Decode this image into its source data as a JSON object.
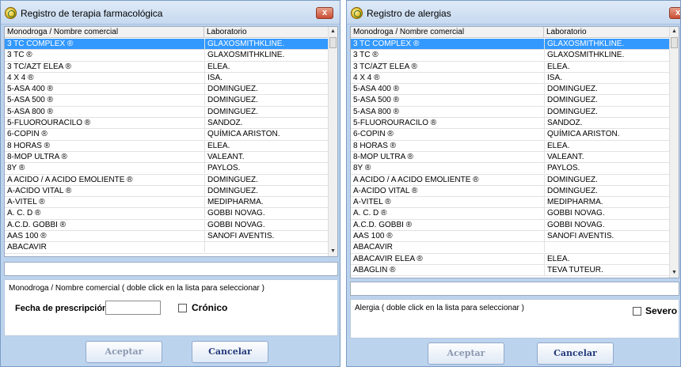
{
  "left_window": {
    "title": "Registro de terapia farmacológica",
    "close_label": "x",
    "columns": {
      "name": "Monodroga / Nombre comercial",
      "lab": "Laboratorio"
    },
    "rows": [
      {
        "name": "3 TC COMPLEX ®",
        "lab": "GLAXOSMITHKLINE."
      },
      {
        "name": "3 TC ®",
        "lab": "GLAXOSMITHKLINE."
      },
      {
        "name": "3 TC/AZT ELEA ®",
        "lab": "ELEA."
      },
      {
        "name": "4 X 4 ®",
        "lab": "ISA."
      },
      {
        "name": "5-ASA 400 ®",
        "lab": "DOMINGUEZ."
      },
      {
        "name": "5-ASA 500 ®",
        "lab": "DOMINGUEZ."
      },
      {
        "name": "5-ASA 800 ®",
        "lab": "DOMINGUEZ."
      },
      {
        "name": "5-FLUOROURACILO ®",
        "lab": "SANDOZ."
      },
      {
        "name": "6-COPIN ®",
        "lab": "QUÍMICA ARISTON."
      },
      {
        "name": "8 HORAS ®",
        "lab": "ELEA."
      },
      {
        "name": "8-MOP ULTRA ®",
        "lab": "VALEANT."
      },
      {
        "name": "8Y ®",
        "lab": "PAYLOS."
      },
      {
        "name": "A ACIDO / A ACIDO EMOLIENTE ®",
        "lab": "DOMINGUEZ."
      },
      {
        "name": "A-ACIDO VITAL ®",
        "lab": "DOMINGUEZ."
      },
      {
        "name": "A-VITEL ®",
        "lab": "MEDIPHARMA."
      },
      {
        "name": "A. C. D ®",
        "lab": "GOBBI NOVAG."
      },
      {
        "name": "A.C.D. GOBBI ®",
        "lab": "GOBBI NOVAG."
      },
      {
        "name": "AAS 100 ®",
        "lab": "SANOFI AVENTIS."
      },
      {
        "name": "ABACAVIR",
        "lab": ""
      }
    ],
    "search_value": "",
    "panel_label": "Monodroga / Nombre comercial  ( doble click en la lista para seleccionar )",
    "date_label": "Fecha de prescripción",
    "date_value": "",
    "chronic_label": "Crónico",
    "accept_label": "Aceptar",
    "cancel_label": "Cancelar"
  },
  "right_window": {
    "title": "Registro de alergias",
    "close_label": "x",
    "columns": {
      "name": "Monodroga / Nombre comercial",
      "lab": "Laboratorio"
    },
    "rows": [
      {
        "name": "3 TC COMPLEX ®",
        "lab": "GLAXOSMITHKLINE."
      },
      {
        "name": "3 TC ®",
        "lab": "GLAXOSMITHKLINE."
      },
      {
        "name": "3 TC/AZT ELEA ®",
        "lab": "ELEA."
      },
      {
        "name": "4 X 4 ®",
        "lab": "ISA."
      },
      {
        "name": "5-ASA 400 ®",
        "lab": "DOMINGUEZ."
      },
      {
        "name": "5-ASA 500 ®",
        "lab": "DOMINGUEZ."
      },
      {
        "name": "5-ASA 800 ®",
        "lab": "DOMINGUEZ."
      },
      {
        "name": "5-FLUOROURACILO ®",
        "lab": "SANDOZ."
      },
      {
        "name": "6-COPIN ®",
        "lab": "QUÍMICA ARISTON."
      },
      {
        "name": "8 HORAS ®",
        "lab": "ELEA."
      },
      {
        "name": "8-MOP ULTRA ®",
        "lab": "VALEANT."
      },
      {
        "name": "8Y ®",
        "lab": "PAYLOS."
      },
      {
        "name": "A ACIDO / A ACIDO EMOLIENTE ®",
        "lab": "DOMINGUEZ."
      },
      {
        "name": "A-ACIDO VITAL ®",
        "lab": "DOMINGUEZ."
      },
      {
        "name": "A-VITEL ®",
        "lab": "MEDIPHARMA."
      },
      {
        "name": "A. C. D ®",
        "lab": "GOBBI NOVAG."
      },
      {
        "name": "A.C.D. GOBBI ®",
        "lab": "GOBBI NOVAG."
      },
      {
        "name": "AAS 100 ®",
        "lab": "SANOFI AVENTIS."
      },
      {
        "name": "ABACAVIR",
        "lab": ""
      },
      {
        "name": "ABACAVIR ELEA ®",
        "lab": "ELEA."
      },
      {
        "name": "ABAGLIN ®",
        "lab": "TEVA TUTEUR."
      }
    ],
    "search_value": "",
    "panel_label": "Alergia  ( doble click en la lista para seleccionar )",
    "severe_label": "Severo",
    "accept_label": "Aceptar",
    "cancel_label": "Cancelar"
  },
  "colors": {
    "window_bg": "#bcd3ee",
    "selection": "#3399ff",
    "close_button": "#c94d33"
  },
  "icons": {
    "app_icon": "medical-app-icon",
    "close_icon": "close-icon",
    "scroll_up": "scroll-up-arrow-icon",
    "scroll_down": "scroll-down-arrow-icon"
  }
}
